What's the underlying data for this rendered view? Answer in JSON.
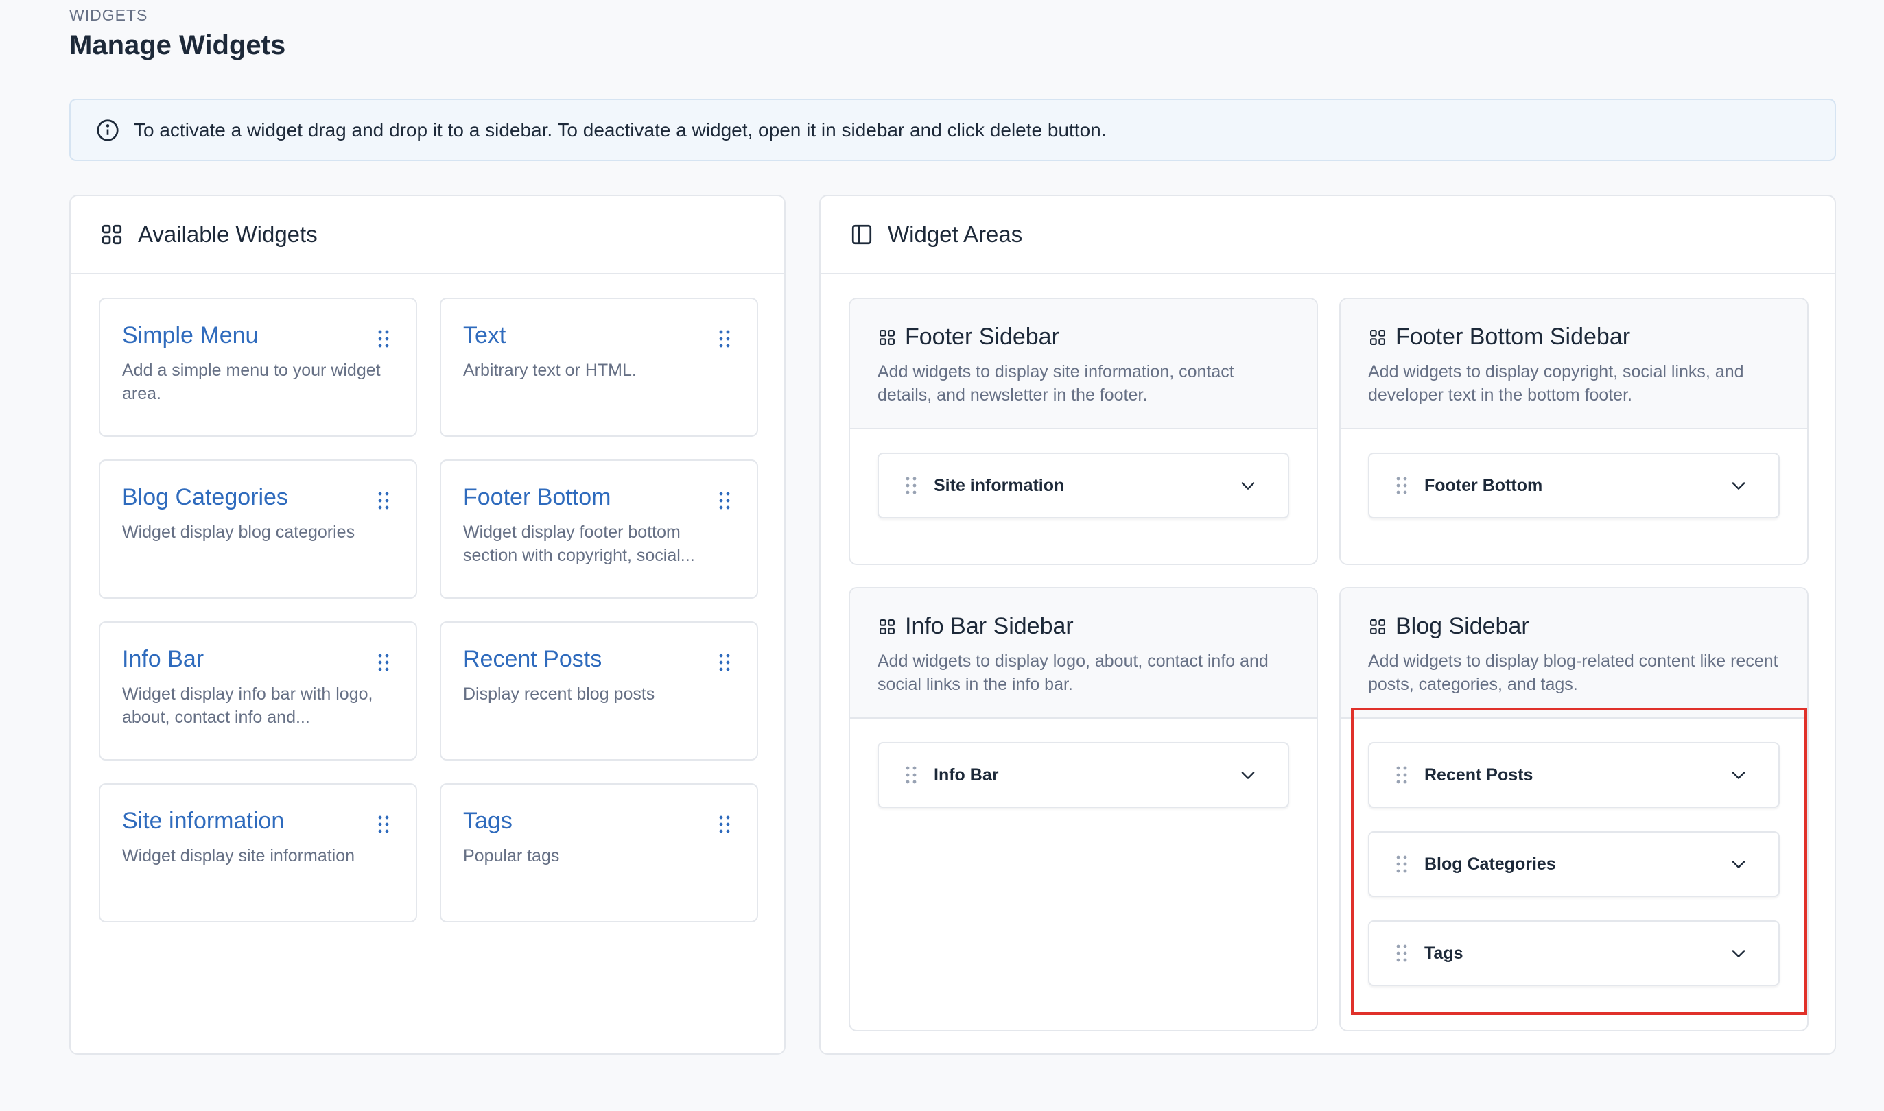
{
  "header": {
    "pretitle": "WIDGETS",
    "title": "Manage Widgets"
  },
  "alert": {
    "icon": "info-icon",
    "text": "To activate a widget drag and drop it to a sidebar. To deactivate a widget, open it in sidebar and click delete button."
  },
  "available": {
    "title": "Available Widgets",
    "icon": "grid-icon",
    "widgets": [
      {
        "title": "Simple Menu",
        "desc": "Add a simple menu to your widget area."
      },
      {
        "title": "Text",
        "desc": "Arbitrary text or HTML."
      },
      {
        "title": "Blog Categories",
        "desc": "Widget display blog categories"
      },
      {
        "title": "Footer Bottom",
        "desc": "Widget display footer bottom section with copyright, social..."
      },
      {
        "title": "Info Bar",
        "desc": "Widget display info bar with logo, about, contact info and..."
      },
      {
        "title": "Recent Posts",
        "desc": "Display recent blog posts"
      },
      {
        "title": "Site information",
        "desc": "Widget display site information"
      },
      {
        "title": "Tags",
        "desc": "Popular tags"
      }
    ]
  },
  "areas": {
    "title": "Widget Areas",
    "icon": "sidebar-panel-icon",
    "list": [
      {
        "title": "Footer Sidebar",
        "desc": "Add widgets to display site information, contact details, and newsletter in the footer.",
        "widgets": [
          "Site information"
        ]
      },
      {
        "title": "Footer Bottom Sidebar",
        "desc": "Add widgets to display copyright, social links, and developer text in the bottom footer.",
        "widgets": [
          "Footer Bottom"
        ]
      },
      {
        "title": "Info Bar Sidebar",
        "desc": "Add widgets to display logo, about, contact info and social links in the info bar.",
        "widgets": [
          "Info Bar"
        ]
      },
      {
        "title": "Blog Sidebar",
        "desc": "Add widgets to display blog-related content like recent posts, categories, and tags.",
        "widgets": [
          "Recent Posts",
          "Blog Categories",
          "Tags"
        ]
      }
    ]
  },
  "colors": {
    "accent": "#2f6bbd",
    "highlight": "#e0312a"
  }
}
